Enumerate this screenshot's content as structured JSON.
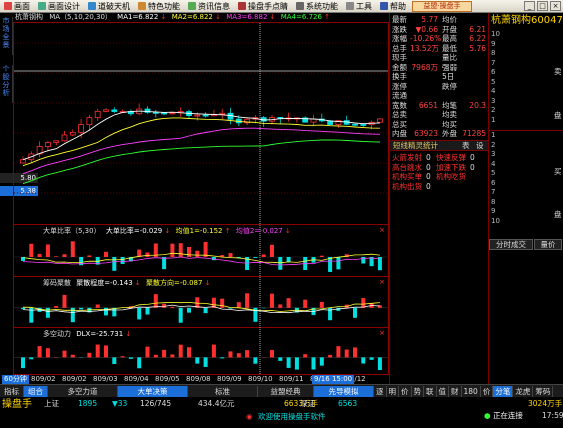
{
  "menu": [
    {
      "label": "画面",
      "icon": "window-icon",
      "color": "#d44"
    },
    {
      "label": "画面设计",
      "icon": "design-icon",
      "color": "#4a8"
    },
    {
      "label": "道破天机",
      "icon": "eye-icon",
      "color": "#38c"
    },
    {
      "label": "特色功能",
      "icon": "star-icon",
      "color": "#c83"
    },
    {
      "label": "资讯信息",
      "icon": "news-icon",
      "color": "#5a5"
    },
    {
      "label": "操盘手点睛",
      "icon": "target-icon",
      "color": "#a33"
    },
    {
      "label": "系统功能",
      "icon": "gear-icon",
      "color": "#666"
    },
    {
      "label": "工具",
      "icon": "tool-icon",
      "color": "#888"
    },
    {
      "label": "帮助",
      "icon": "help-icon",
      "color": "#35a"
    }
  ],
  "brand_badge": "益盟·操盘手",
  "window_controls": [
    "_",
    "□",
    "×"
  ],
  "left_tabs": [
    "市场全景",
    "个股分析"
  ],
  "price_markers": [
    "5.80",
    "5.38"
  ],
  "ma_legend": {
    "name": "杭萧钢构",
    "ma_params": "MA（5,10,20,30）",
    "ma1": "MA1=6.822",
    "ma2": "MA2=6.822",
    "ma3": "MA3=6.882",
    "ma4": "MA4=6.726"
  },
  "indicator1": {
    "title": "大单比率（5,30）",
    "v1": "大单比率=-0.029",
    "v2": "均值1=-0.152",
    "v3": "均值2=-0.027"
  },
  "indicator2": {
    "title": "筹码聚散",
    "v1": "聚散程度=-0.143",
    "v2": "聚散方向=-0.087"
  },
  "indicator3": {
    "title": "多空动力",
    "v1": "DLX=-25.731"
  },
  "date_axis": [
    "809/02",
    "809/02",
    "809/03",
    "809/04",
    "809/05",
    "809/08",
    "809/09",
    "809/10",
    "809/11",
    "809/11",
    "809/12"
  ],
  "time_label": "9/16 15:00",
  "period_label": "60分钟",
  "right_panel": [
    {
      "k": "最新",
      "v": "5.77",
      "k2": "均价",
      "v2": ""
    },
    {
      "k": "涨跌",
      "v": "▼0.66",
      "k2": "开盘",
      "v2": "6.21"
    },
    {
      "k": "涨幅",
      "v": "-10.26%",
      "k2": "最高",
      "v2": "6.22"
    },
    {
      "k": "总手",
      "v": "13.52万",
      "k2": "最低",
      "v2": "5.76"
    },
    {
      "k": "现手",
      "v": "",
      "k2": "量比",
      "v2": ""
    },
    {
      "k": "金额",
      "v": "7968万",
      "k2": "强弱",
      "v2": ""
    },
    {
      "k": "换手",
      "v": "",
      "k2": "5日",
      "v2": ""
    },
    {
      "k": "涨停",
      "v": "",
      "k2": "跌停",
      "v2": ""
    },
    {
      "k": "流通",
      "v": "",
      "k2": "",
      "v2": ""
    },
    {
      "k": "宽数",
      "v": "6651",
      "k2": "均笔",
      "v2": "20.3"
    },
    {
      "k": "总卖",
      "v": "",
      "k2": "均卖",
      "v2": ""
    },
    {
      "k": "总买",
      "v": "",
      "k2": "均买",
      "v2": ""
    },
    {
      "k": "内盘",
      "v": "63923",
      "k2": "外盘",
      "v2": "71285"
    }
  ],
  "elf_panel": {
    "title": "短线精灵统计",
    "tabs": [
      "表",
      "设"
    ],
    "rows": [
      {
        "a": "火箭发射",
        "n1": "0",
        "b": "快速反弹",
        "n2": "0"
      },
      {
        "a": "高台跳水",
        "n1": "0",
        "b": "加速下跌",
        "n2": "0"
      },
      {
        "a": "机构买单",
        "n1": "0",
        "b": "机构吃货",
        "n2": ""
      },
      {
        "a": "机构出货",
        "n1": "0",
        "b": "",
        "n2": ""
      }
    ]
  },
  "stock_title": "杭萧钢构600477",
  "sell_label": "卖",
  "buy_label": "买",
  "pan_label": "盘",
  "ladder_sell": [
    "10",
    "9",
    "8",
    "7",
    "6",
    "5",
    "4",
    "3",
    "2",
    "1"
  ],
  "ladder_buy": [
    "1",
    "2",
    "3",
    "4",
    "5",
    "6",
    "7",
    "8",
    "9",
    "10"
  ],
  "right_bottom_tabs": [
    "分时成交",
    "量价"
  ],
  "period_tabs": [
    "指标",
    "组合",
    "多空力道",
    "大单决策",
    "标准",
    "益盟经典",
    "先导模拟"
  ],
  "period_tab_right": [
    "逐",
    "明",
    "价",
    "势",
    "联",
    "值",
    "财",
    "180",
    "价",
    "分笔",
    "龙虎",
    "筹码"
  ],
  "status": {
    "logo": "操盘手",
    "idx1_name": "上证",
    "idx1_val": "1895",
    "idx1_chg": "▼33",
    "idx1_ratio": "126/745",
    "idx1_amt": "434.4亿元",
    "idx2_name": "深证",
    "idx2_val": "6633万手",
    "idx2_chg": "6563",
    "idx2_extra": "",
    "idx3_amt": "3024万手",
    "welcome": "欢迎使用操盘手软件",
    "connecting": "正在连接",
    "time": "17:59"
  },
  "colors": {
    "up": "#ff3030",
    "down": "#00e0e0",
    "ma5": "#ffffff",
    "ma10": "#ffff30",
    "ma20": "#ff40ff",
    "ma30": "#30ff30",
    "grid": "#8a0000",
    "active_tab": "#1c6fd8"
  }
}
